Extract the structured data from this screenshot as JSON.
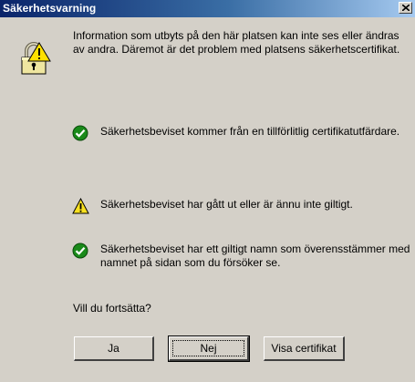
{
  "window": {
    "title": "Säkerhetsvarning",
    "close_icon": "close-icon"
  },
  "intro_text": "Information som utbyts på den här platsen kan inte ses eller ändras av andra. Däremot är det problem med platsens säkerhetscertifikat.",
  "icons": {
    "main": "lock-warning-icon",
    "ok": "check-icon",
    "warning": "warning-icon"
  },
  "colors": {
    "titlebar_start": "#0a246a",
    "titlebar_end": "#a6caf0",
    "check_green": "#1a8a1a",
    "warning_yellow": "#f8e020"
  },
  "status_items": [
    {
      "type": "ok",
      "text": "Säkerhetsbeviset kommer från en tillförlitlig certifikatutfärdare."
    },
    {
      "type": "warning",
      "text": "Säkerhetsbeviset har gått ut eller är ännu inte giltigt."
    },
    {
      "type": "ok",
      "text": "Säkerhetsbeviset har ett giltigt namn som överensstämmer med namnet på sidan som du försöker se."
    }
  ],
  "question": "Vill du fortsätta?",
  "buttons": {
    "yes": "Ja",
    "no": "Nej",
    "view_certificate": "Visa certifikat"
  }
}
